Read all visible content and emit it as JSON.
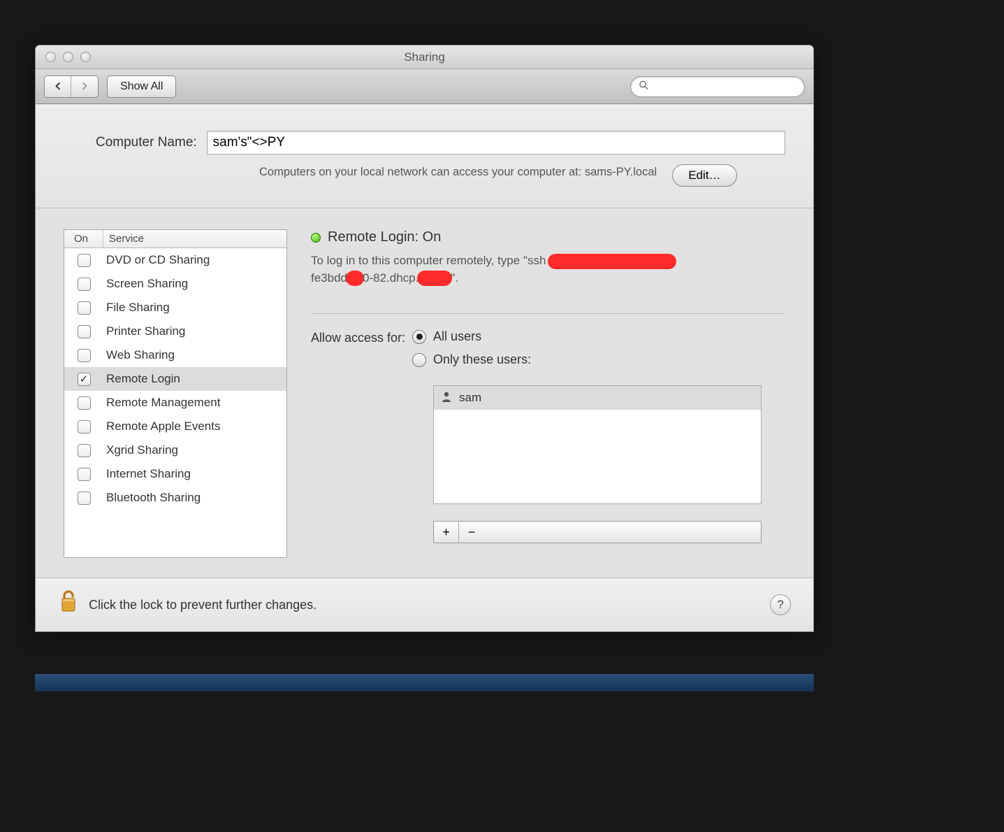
{
  "window": {
    "title": "Sharing"
  },
  "toolbar": {
    "show_all": "Show All",
    "search_placeholder": ""
  },
  "computer_name": {
    "label": "Computer Name:",
    "value": "sam's\"<>PY",
    "help": "Computers on your local network can access your computer at: sams-PY.local",
    "edit_label": "Edit…"
  },
  "services": {
    "head_on": "On",
    "head_service": "Service",
    "items": [
      {
        "label": "DVD or CD Sharing",
        "on": false,
        "selected": false
      },
      {
        "label": "Screen Sharing",
        "on": false,
        "selected": false
      },
      {
        "label": "File Sharing",
        "on": false,
        "selected": false
      },
      {
        "label": "Printer Sharing",
        "on": false,
        "selected": false
      },
      {
        "label": "Web Sharing",
        "on": false,
        "selected": false
      },
      {
        "label": "Remote Login",
        "on": true,
        "selected": true
      },
      {
        "label": "Remote Management",
        "on": false,
        "selected": false
      },
      {
        "label": "Remote Apple Events",
        "on": false,
        "selected": false
      },
      {
        "label": "Xgrid Sharing",
        "on": false,
        "selected": false
      },
      {
        "label": "Internet Sharing",
        "on": false,
        "selected": false
      },
      {
        "label": "Bluetooth Sharing",
        "on": false,
        "selected": false
      }
    ]
  },
  "detail": {
    "status": "Remote Login: On",
    "instr_prefix": "To log in to this computer remotely, type \"ssh",
    "instr_mid": "fe3bdd",
    "instr_mid2": "0-82.dhcp.",
    "instr_suffix": "\".",
    "access_label": "Allow access for:",
    "radio_all": "All users",
    "radio_only": "Only these users:",
    "selected_access": "all",
    "users": [
      {
        "name": "sam"
      }
    ]
  },
  "footer": {
    "text": "Click the lock to prevent further changes."
  }
}
